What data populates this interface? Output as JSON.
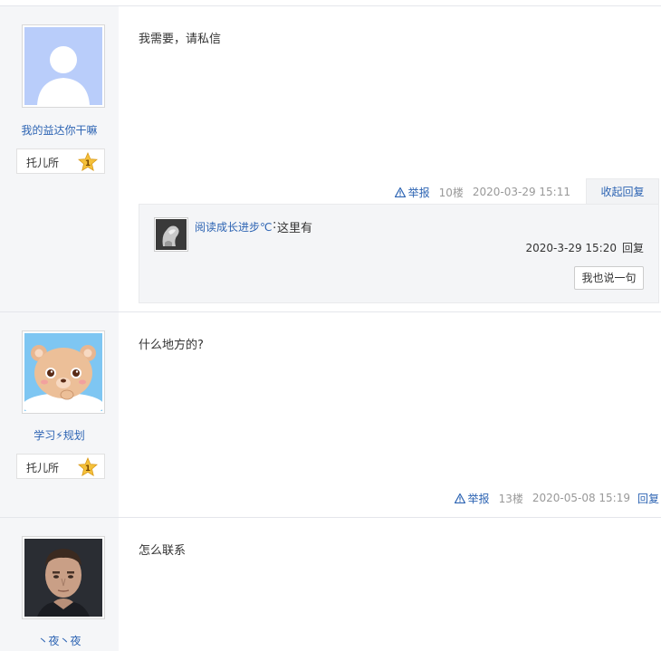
{
  "posts": [
    {
      "user": {
        "name": "我的益达你干嘛",
        "avatar": "default-avatar"
      },
      "badge": {
        "label": "托儿所",
        "level": "1"
      },
      "content": "我需要，请私信",
      "meta": {
        "report": "举报",
        "floor": "10楼",
        "time": "2020-03-29 15:11",
        "action": "收起回复"
      },
      "sub_reply": {
        "user": "阅读成长进步℃",
        "separator": ":",
        "text": "这里有",
        "time": "2020-3-29 15:20",
        "reply": "回复",
        "say_button": "我也说一句"
      }
    },
    {
      "user": {
        "name": "学习⚡规划",
        "avatar": "bear-avatar"
      },
      "badge": {
        "label": "托儿所",
        "level": "1"
      },
      "content": "什么地方的?",
      "meta": {
        "report": "举报",
        "floor": "13楼",
        "time": "2020-05-08 15:19",
        "action": "回复"
      }
    },
    {
      "user": {
        "name": "丶夜丶夜",
        "avatar": "portrait-avatar"
      },
      "content": "怎么联系"
    }
  ],
  "colors": {
    "link": "#2d64b3",
    "sidebar": "#f5f6f8",
    "badge_star": "#f5c13a"
  }
}
